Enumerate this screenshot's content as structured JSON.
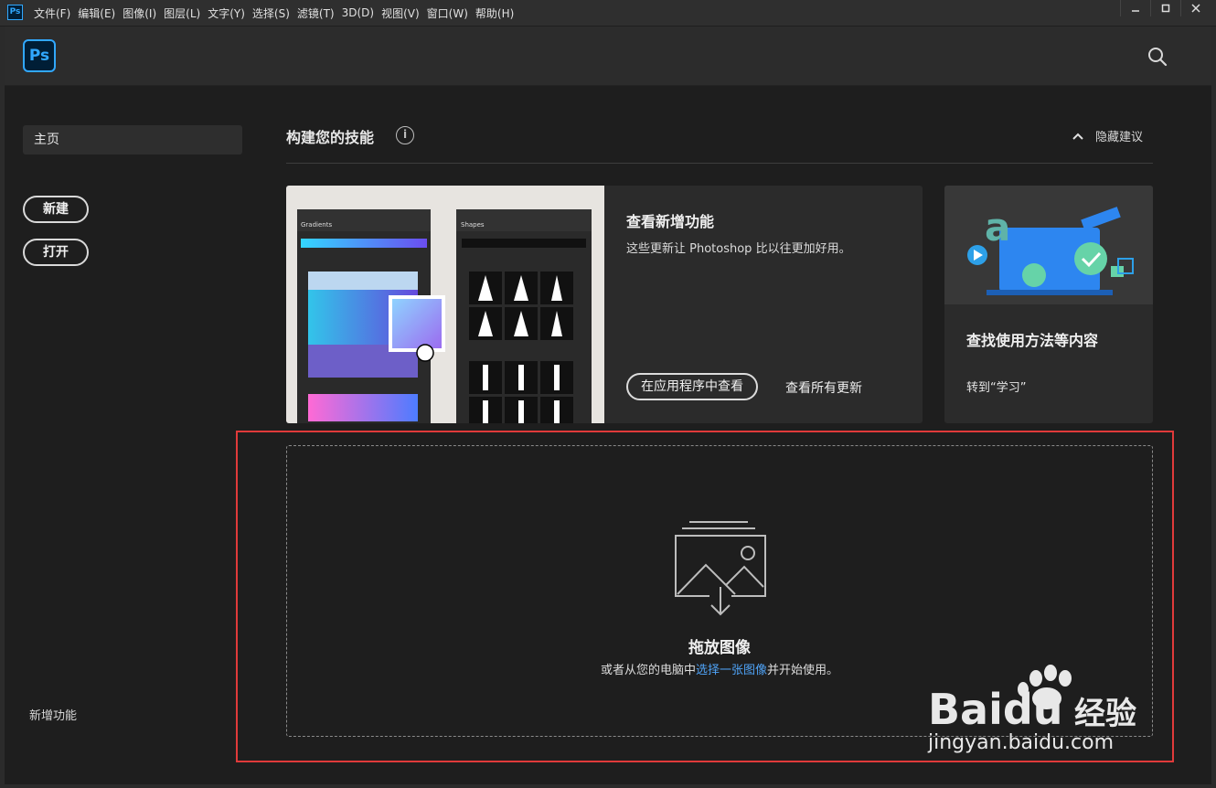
{
  "app": {
    "mini_logo": "Ps",
    "logo": "Ps"
  },
  "menu": [
    "文件(F)",
    "编辑(E)",
    "图像(I)",
    "图层(L)",
    "文字(Y)",
    "选择(S)",
    "滤镜(T)",
    "3D(D)",
    "视图(V)",
    "窗口(W)",
    "帮助(H)"
  ],
  "window_controls": [
    "minimize-icon",
    "restore-icon",
    "close-icon"
  ],
  "sidebar": {
    "home": "主页",
    "new_btn": "新建",
    "open_btn": "打开",
    "whats_new": "新增功能"
  },
  "skills": {
    "title": "构建您的技能",
    "info": "i",
    "hide": "隐藏建议"
  },
  "card_whats_new": {
    "title": "查看新增功能",
    "desc": "这些更新让 Photoshop 比以往更加好用。",
    "btn": "在应用程序中查看",
    "link": "查看所有更新",
    "panel_gradients": "Gradients",
    "panel_shapes": "Shapes"
  },
  "card_learn": {
    "title": "查找使用方法等内容",
    "link": "转到“学习”",
    "illustration_letter": "a"
  },
  "dropzone": {
    "title": "拖放图像",
    "sub_before": "或者从您的电脑中",
    "sub_link": "选择一张图像",
    "sub_after": "并开始使用。"
  },
  "watermark": {
    "url": "jingyan.baidu.com",
    "brand": "Baidu",
    "brand_cn": "经验"
  },
  "colors": {
    "accent_blue": "#31a8ff",
    "link_blue": "#4fa3f7",
    "highlight_red": "#e03a3a"
  }
}
